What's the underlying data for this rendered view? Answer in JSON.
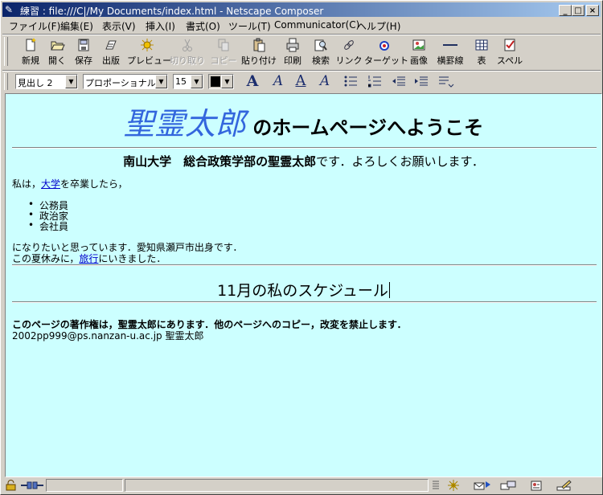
{
  "window": {
    "title": "練習 : file:///C|/My Documents/index.html - Netscape Composer",
    "minimize": "_",
    "maximize": "□",
    "close": "×"
  },
  "menu": [
    "ファイル(F)",
    "編集(E)",
    "表示(V)",
    "挿入(I)",
    "書式(O)",
    "ツール(T)",
    "Communicator(C)",
    "ヘルプ(H)"
  ],
  "toolbar": [
    {
      "label": "新規",
      "icon": "new-icon",
      "enabled": true
    },
    {
      "label": "開く",
      "icon": "open-icon",
      "enabled": true
    },
    {
      "label": "保存",
      "icon": "save-icon",
      "enabled": true
    },
    {
      "label": "出版",
      "icon": "publish-icon",
      "enabled": true
    },
    {
      "label": "プレビュー",
      "icon": "preview-icon",
      "enabled": true
    },
    {
      "label": "切り取り",
      "icon": "cut-icon",
      "enabled": false
    },
    {
      "label": "コピー",
      "icon": "copy-icon",
      "enabled": false
    },
    {
      "label": "貼り付け",
      "icon": "paste-icon",
      "enabled": true
    },
    {
      "label": "印刷",
      "icon": "print-icon",
      "enabled": true
    },
    {
      "label": "検索",
      "icon": "find-icon",
      "enabled": true
    },
    {
      "label": "リンク",
      "icon": "link-icon",
      "enabled": true
    },
    {
      "label": "ターゲット",
      "icon": "target-icon",
      "enabled": true
    },
    {
      "label": "画像",
      "icon": "image-icon",
      "enabled": true
    },
    {
      "label": "横罫線",
      "icon": "hrule-icon",
      "enabled": true
    },
    {
      "label": "表",
      "icon": "table-icon",
      "enabled": true
    },
    {
      "label": "スペル",
      "icon": "spell-icon",
      "enabled": true
    }
  ],
  "format": {
    "paragraph_style": "見出し 2",
    "font": "プロポーショナル",
    "size": "15",
    "color": "#000000"
  },
  "document": {
    "title_emphasis": "聖霊太郎",
    "title_rest": " のホームページへようこそ",
    "intro_bold": "南山大学　総合政策学部の聖霊太郎",
    "intro_rest": "です．よろしくお願いします．",
    "p1_before": "私は，",
    "p1_link": "大学",
    "p1_after": "を卒業したら，",
    "list": [
      "公務員",
      "政治家",
      "会社員"
    ],
    "p2": "になりたいと思っています．愛知県瀬戸市出身です．",
    "p3_before": "この夏休みに，",
    "p3_link": "旅行",
    "p3_after": "にいきました．",
    "schedule_heading": "11月の私のスケジュール",
    "copyright": "このページの著作権は，聖霊太郎にあります．他のページへのコピー，改変を禁止します．",
    "contact": "2002pp999@ps.nanzan-u.ac.jp 聖霊太郎"
  }
}
